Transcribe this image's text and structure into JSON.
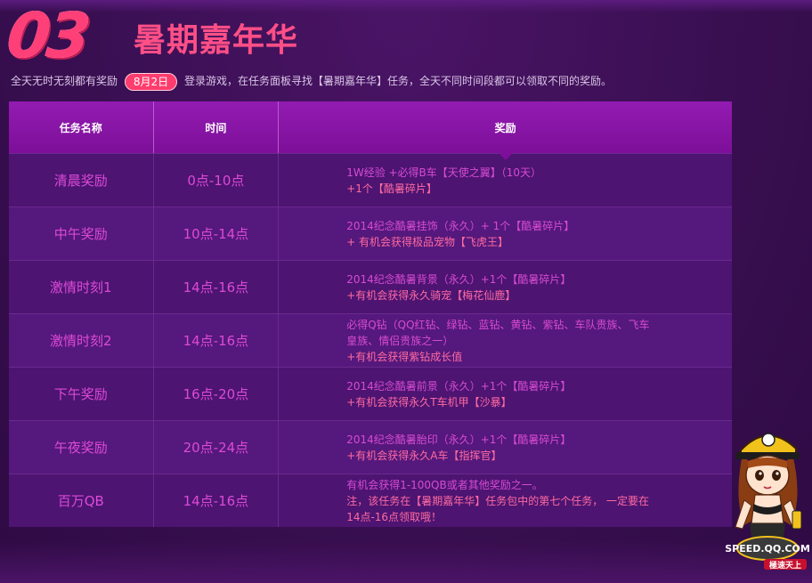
{
  "header": {
    "number": "03",
    "title": "暑期嘉年华",
    "intro_before": "全天无时无刻都有奖励",
    "date_badge": "8月2日",
    "intro_after": "登录游戏，在任务面板寻找【暑期嘉年华】任务，全天不同时间段都可以领取不同的奖励。"
  },
  "table": {
    "columns": [
      "任务名称",
      "时间",
      "奖励"
    ],
    "rows": [
      {
        "name": "清晨奖励",
        "time": "0点-10点",
        "reward": [
          "1W经验 +必得B车【天使之翼】（10天）",
          "+1个【酷暑碎片】"
        ]
      },
      {
        "name": "中午奖励",
        "time": "10点-14点",
        "reward": [
          "2014纪念酷暑挂饰（永久）+ 1个【酷暑碎片】",
          "+ 有机会获得极品宠物【飞虎王】"
        ]
      },
      {
        "name": "激情时刻1",
        "time": "14点-16点",
        "reward": [
          "2014纪念酷暑背景（永久）+1个【酷暑碎片】",
          "+有机会获得永久骑宠【梅花仙鹿】"
        ]
      },
      {
        "name": "激情时刻2",
        "time": "14点-16点",
        "reward": [
          "必得Q钻（QQ红钻、绿钻、蓝钻、黄钻、紫钻、车队贵族、飞车",
          "皇族、情侣贵族之一）",
          "+有机会获得紫钻成长值"
        ]
      },
      {
        "name": "下午奖励",
        "time": "16点-20点",
        "reward": [
          "2014纪念酷暑前景（永久）+1个【酷暑碎片】",
          "+有机会获得永久T车机甲【沙暴】"
        ]
      },
      {
        "name": "午夜奖励",
        "time": "20点-24点",
        "reward": [
          "2014纪念酷暑胎印（永久）+1个【酷暑碎片】",
          "+有机会获得永久A车【指挥官】"
        ]
      },
      {
        "name": "百万QB",
        "time": "14点-16点",
        "reward": [
          "有机会获得1-100QB或者其他奖励之一。",
          "注，该任务在【暑期嘉年华】任务包中的第七个任务， 一定要在",
          "14点-16点领取哦！"
        ]
      }
    ]
  },
  "mascot": {
    "icon": "mascot-girl-icon",
    "logo_text": "SPEED.QQ.COM",
    "slogan": "極速天上"
  },
  "colors": {
    "background": "#3a0f52",
    "accent": "#ff3f78",
    "header_row": "#8a14a8",
    "text": "#dc4ad6"
  }
}
